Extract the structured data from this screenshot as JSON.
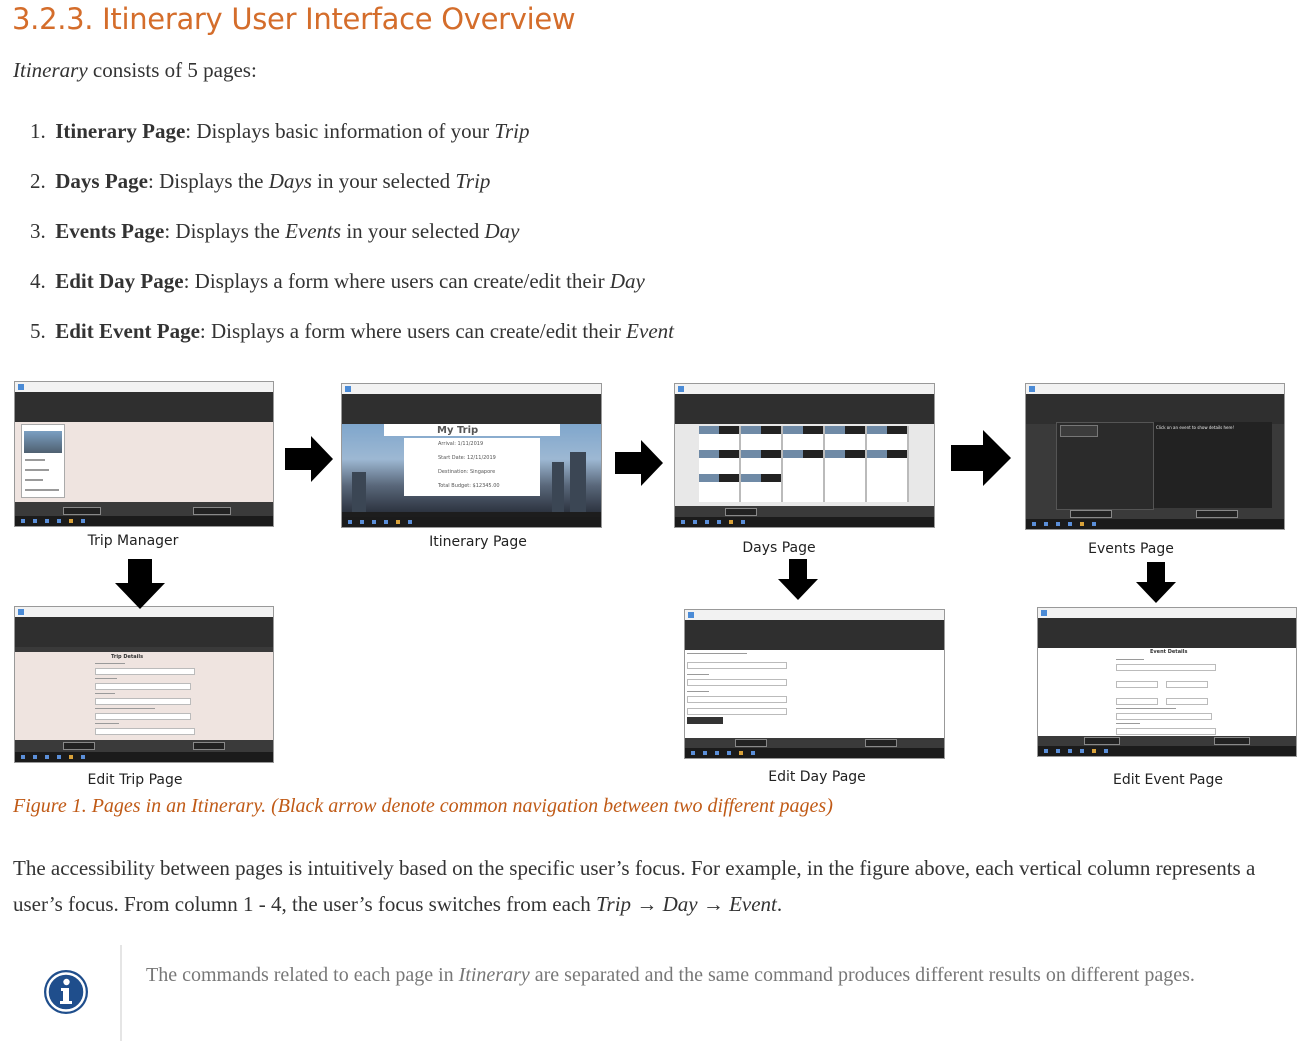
{
  "heading": "3.2.3. Itinerary User Interface Overview",
  "intro": {
    "italic": "Itinerary",
    "rest": " consists of 5 pages:"
  },
  "pages": [
    {
      "num": "1.",
      "name": "Itinerary Page",
      "pre": ": Displays basic information of your ",
      "em": "Trip",
      "post": ""
    },
    {
      "num": "2.",
      "name": "Days Page",
      "pre": ": Displays the ",
      "em": "Days",
      "post": " in your selected ",
      "em2": "Trip"
    },
    {
      "num": "3.",
      "name": "Events Page",
      "pre": ": Displays the ",
      "em": "Events",
      "post": " in your selected ",
      "em2": "Day"
    },
    {
      "num": "4.",
      "name": "Edit Day Page",
      "pre": ": Displays a form where users can create/edit their ",
      "em": "Day",
      "post": ""
    },
    {
      "num": "5.",
      "name": "Edit Event Page",
      "pre": ": Displays a form where users can create/edit their ",
      "em": "Event",
      "post": ""
    }
  ],
  "figure": {
    "captions": {
      "trip_manager": "Trip Manager",
      "itinerary_page": "Itinerary Page",
      "days_page": "Days Page",
      "events_page": "Events Page",
      "edit_trip_page": "Edit Trip Page",
      "edit_day_page": "Edit Day Page",
      "edit_event_page": "Edit Event Page"
    },
    "screens": {
      "my_trip_title": "My Trip",
      "arrival": "Arrival: 1/11/2019",
      "start_date": "Start Date: 12/11/2019",
      "destination": "Destination: Singapore",
      "total_budget": "Total Budget: $12345.00",
      "trip_details": "Trip Details",
      "event_details": "Event Details",
      "events_hint": "Click on an event to show details here!"
    },
    "caption": "Figure 1. Pages in an Itinerary. (Black arrow denote common navigation between two different pages)"
  },
  "paragraph": {
    "text": "The accessibility between pages is intuitively based on the specific user’s focus. For example, in the figure above, each vertical column represents a user’s focus. From column 1 - 4, the user’s focus switches from each ",
    "trip": "Trip",
    "arrow": " → ",
    "day": "Day",
    "event": "Event",
    "end": "."
  },
  "note": {
    "pre": "The commands related to each page in ",
    "em": "Itinerary",
    "post": " are separated and the same command produces different results on different pages."
  },
  "colors": {
    "heading": "#d46d2b",
    "caption": "#c05a16",
    "info_icon": "#1f4e8c"
  }
}
